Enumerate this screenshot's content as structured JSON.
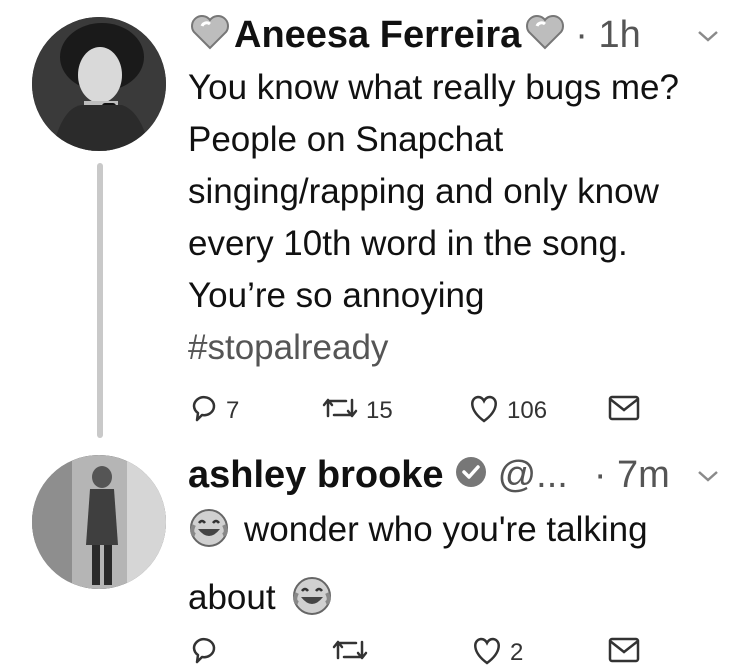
{
  "tweets": [
    {
      "name": "Aneesa Ferreira",
      "handle": "",
      "time": "· 1h",
      "text": "You know what really bugs me? People on Snapchat singing/rapping and only know every 10th word in the song. You’re so annoying",
      "hashtag": "#stopalready",
      "replies": "7",
      "retweets": "15",
      "likes": "106"
    },
    {
      "name": "ashley brooke",
      "handle": "@...",
      "time": "· 7m",
      "text_line1": "wonder who you're talking",
      "text_line2": "about",
      "replies": "",
      "retweets": "",
      "likes": "2"
    }
  ],
  "icons": {
    "heart_emoji": "heart-icon",
    "laugh_emoji": "tears-of-joy-icon",
    "verified": "verified-badge-icon"
  }
}
